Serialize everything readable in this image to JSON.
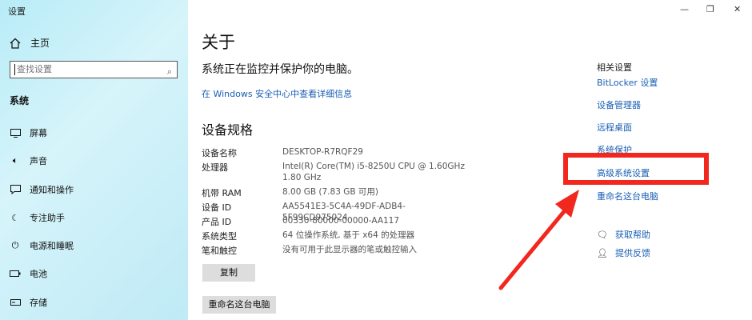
{
  "window": {
    "title": "设置",
    "minimize": "—",
    "restore": "❐",
    "close": "✕"
  },
  "sidebar": {
    "home_label": "主页",
    "search_placeholder": "查找设置",
    "section": "系统",
    "items": [
      {
        "label": "屏幕",
        "icon": "monitor-icon"
      },
      {
        "label": "声音",
        "icon": "speaker-icon"
      },
      {
        "label": "通知和操作",
        "icon": "notification-icon"
      },
      {
        "label": "专注助手",
        "icon": "moon-icon"
      },
      {
        "label": "电源和睡眠",
        "icon": "power-icon"
      },
      {
        "label": "电池",
        "icon": "battery-icon"
      },
      {
        "label": "存储",
        "icon": "storage-icon"
      }
    ]
  },
  "main": {
    "title": "关于",
    "subtitle": "系统正在监控并保护你的电脑。",
    "security_link": "在 Windows 安全中心中查看详细信息",
    "specs_title": "设备规格",
    "specs": [
      {
        "label": "设备名称",
        "value": "DESKTOP-R7RQF29"
      },
      {
        "label": "处理器",
        "value": "Intel(R) Core(TM) i5-8250U CPU @ 1.60GHz   1.80 GHz"
      },
      {
        "label": "机带 RAM",
        "value": "8.00 GB (7.83 GB 可用)"
      },
      {
        "label": "设备 ID",
        "value": "AA5541E3-5C4A-49DF-ADB4-5F99CD975024"
      },
      {
        "label": "产品 ID",
        "value": "00330-80000-00000-AA117"
      },
      {
        "label": "系统类型",
        "value": "64 位操作系统, 基于 x64 的处理器"
      },
      {
        "label": "笔和触控",
        "value": "没有可用于此显示器的笔或触控输入"
      }
    ],
    "copy_button": "复制",
    "rename_button": "重命名这台电脑"
  },
  "related": {
    "heading": "相关设置",
    "links": [
      "BitLocker 设置",
      "设备管理器",
      "远程桌面",
      "系统保护",
      "高级系统设置",
      "重命名这台电脑"
    ],
    "help": [
      {
        "label": "获取帮助",
        "icon": "help-chat-icon"
      },
      {
        "label": "提供反馈",
        "icon": "feedback-icon"
      }
    ]
  },
  "annotation": {
    "highlight_color": "#f2281f"
  }
}
